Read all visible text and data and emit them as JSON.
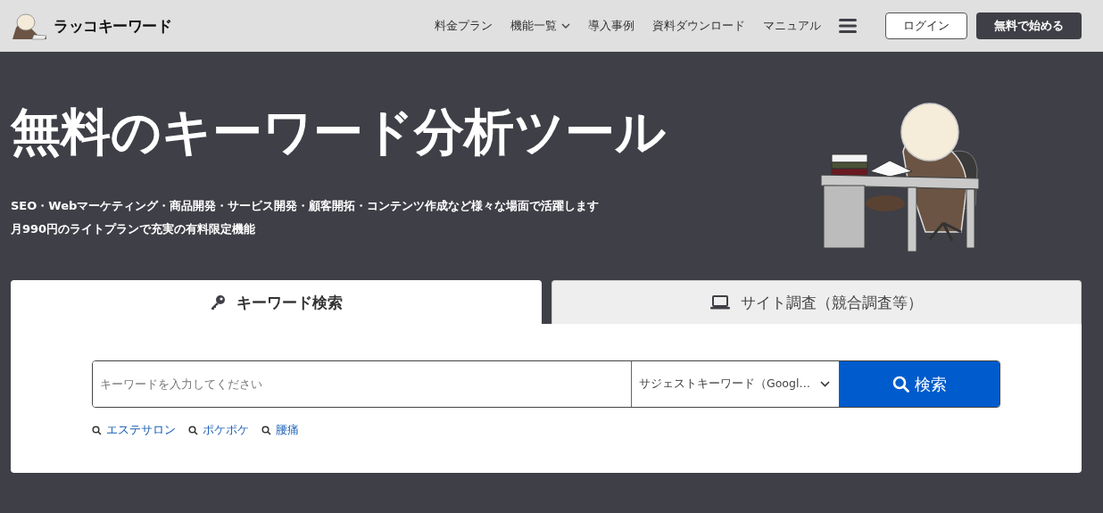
{
  "header": {
    "logo_text": "ラッコキーワード",
    "nav": [
      {
        "label": "料金プラン",
        "dropdown": false
      },
      {
        "label": "機能一覧",
        "dropdown": true
      },
      {
        "label": "導入事例",
        "dropdown": false
      },
      {
        "label": "資料ダウンロード",
        "dropdown": false
      },
      {
        "label": "マニュアル",
        "dropdown": false
      }
    ],
    "login_button": "ログイン",
    "signup_button": "無料で始める"
  },
  "hero": {
    "title": "無料のキーワード分析ツール",
    "lines": [
      "SEO・Webマーケティング・商品開発・サービス開発・顧客開拓・コンテンツ作成など様々な場面で活躍します",
      "月990円のライトプランで充実の有料限定機能"
    ]
  },
  "search_tabs": [
    {
      "label": "キーワード検索",
      "selected": true
    },
    {
      "label": "サイト調査（競合調査等）",
      "selected": false
    }
  ],
  "search": {
    "placeholder": "キーワードを入力してください",
    "mode": "サジェストキーワード（Googl…",
    "button": "検索"
  },
  "suggestions": [
    "エステサロン",
    "ポケポケ",
    "腰痛"
  ]
}
